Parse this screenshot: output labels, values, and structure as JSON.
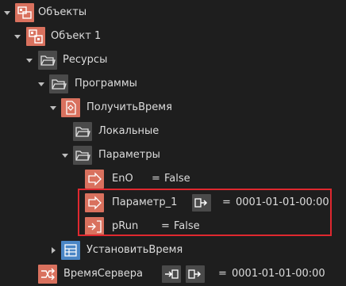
{
  "tree": {
    "root": {
      "label": "Объекты"
    },
    "object1": {
      "label": "Объект 1"
    },
    "resources": {
      "label": "Ресурсы"
    },
    "programs": {
      "label": "Программы"
    },
    "get_time": {
      "label": "ПолучитьВремя"
    },
    "locals": {
      "label": "Локальные"
    },
    "params": {
      "label": "Параметры"
    },
    "eno": {
      "label": "EnO",
      "eq": "=",
      "value": "False"
    },
    "param1": {
      "label": "Параметр_1",
      "eq": "=",
      "value": "0001-01-01-00:00"
    },
    "prun": {
      "label": "pRun",
      "eq": "=",
      "value": "False"
    },
    "set_time": {
      "label": "УстановитьВремя"
    },
    "server_time": {
      "label": "ВремяСервера",
      "eq": "=",
      "value": "0001-01-01-00:00"
    }
  },
  "colors": {
    "background": "#1e1e1e",
    "icon_red": "#d9715e",
    "icon_dark": "#4a4a4a",
    "icon_blue": "#4a86c5",
    "highlight": "#e0282f",
    "text": "#dcdcdc"
  },
  "icons": {
    "root": "object-group-icon",
    "object": "object-icon",
    "folder": "folder-open-icon",
    "program": "program-icon",
    "output_param": "output-arrow-icon",
    "input_param": "input-arrow-icon",
    "link_out": "link-out-icon",
    "link_in": "link-in-icon",
    "task": "task-icon"
  }
}
